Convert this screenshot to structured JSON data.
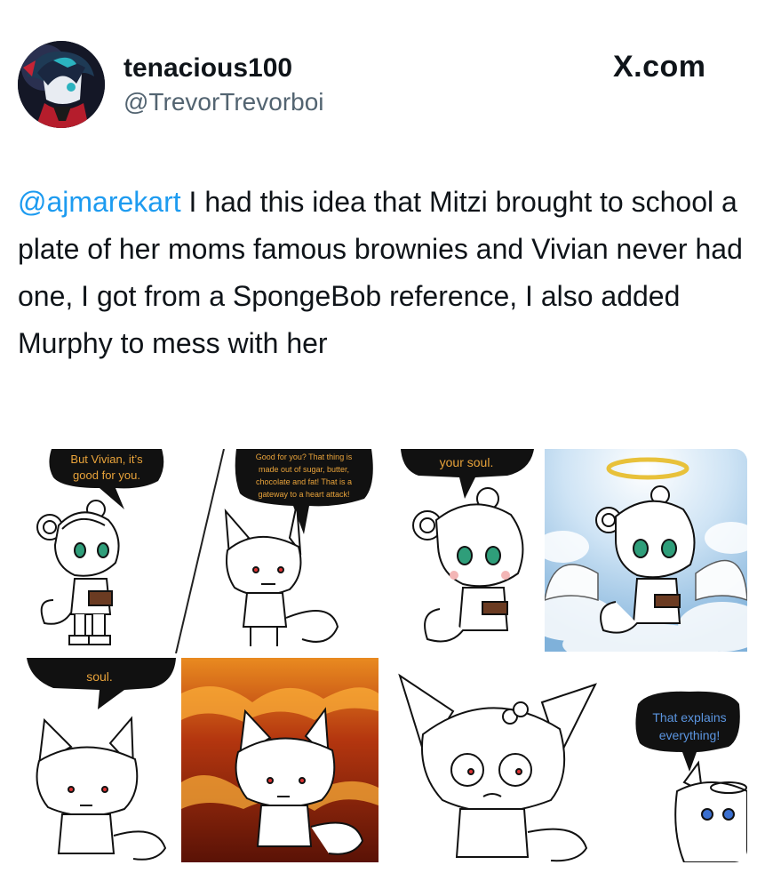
{
  "user": {
    "display_name": "tenacious100",
    "handle": "@TrevorTrevorboi",
    "avatar_icon": "avatar-icon"
  },
  "source_label": "X.com",
  "tweet": {
    "mention": "@ajmarekart",
    "body": " I had this idea that Mitzi brought to school a plate of her moms famous brownies and Vivian never had one, I got from a SpongeBob reference, I also added Murphy to mess with her"
  },
  "comic": {
    "panel1_lines": [
      "But Vivian, it’s",
      "good for you."
    ],
    "panel2_lines": [
      "Good for you? That thing is",
      "made out of sugar, butter,",
      "chocolate and fat! That is a",
      "gateway to a heart attack!"
    ],
    "panel3_lines": [
      "your soul."
    ],
    "panel5_lines": [
      "soul."
    ],
    "panel8_lines": [
      "That explains",
      "everything!"
    ]
  },
  "colors": {
    "mention": "#1d9bf0",
    "handle": "#536471",
    "bubble": "#111111",
    "bubble_text": "#e9a33a",
    "bubble_text_blue": "#5b95e0"
  }
}
